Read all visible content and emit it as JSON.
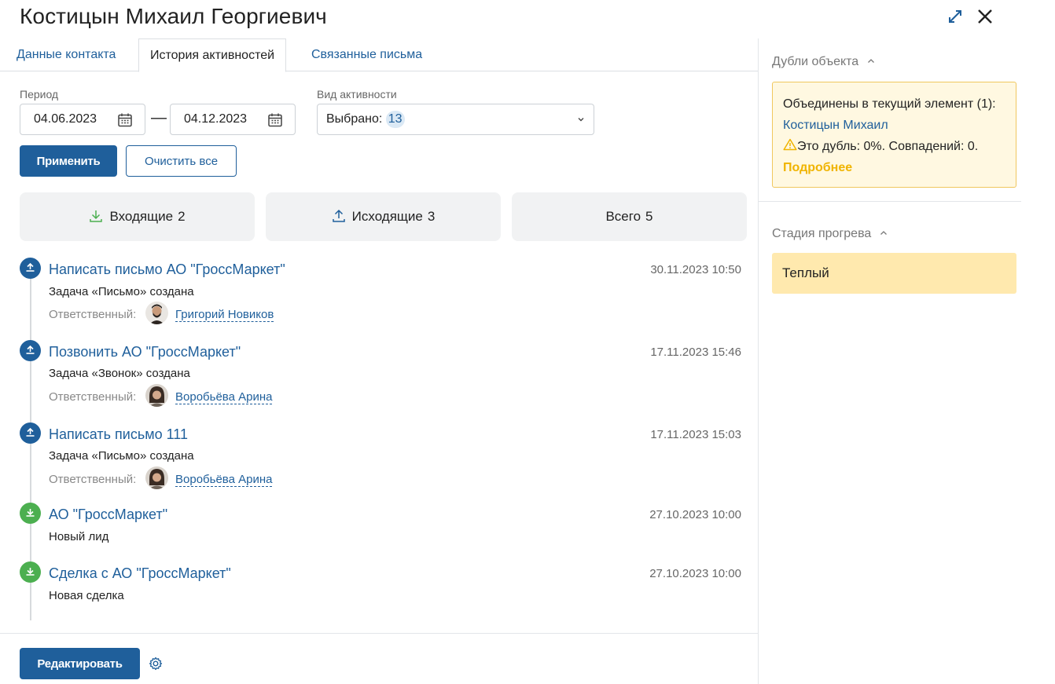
{
  "header": {
    "title": "Костицын Михаил Георгиевич"
  },
  "tabs": [
    {
      "label": "Данные контакта"
    },
    {
      "label": "История активностей"
    },
    {
      "label": "Связанные письма"
    }
  ],
  "filters": {
    "period_label": "Период",
    "date_from": "04.06.2023",
    "dash": "—",
    "date_to": "04.12.2023",
    "activity_type_label": "Вид активности",
    "selected_prefix": "Выбрано:",
    "selected_count": "13",
    "apply_label": "Применить",
    "clear_label": "Очистить все"
  },
  "stats": {
    "incoming_label": "Входящие",
    "incoming_count": "2",
    "outgoing_label": "Исходящие",
    "outgoing_count": "3",
    "total_label": "Всего",
    "total_count": "5"
  },
  "activities": [
    {
      "direction": "out",
      "title": "Написать письмо АО \"ГроссМаркет\"",
      "date": "30.11.2023 10:50",
      "subtitle": "Задача «Письмо» создана",
      "responsible_label": "Ответственный:",
      "responsible": "Григорий Новиков"
    },
    {
      "direction": "out",
      "title": "Позвонить АО \"ГроссМаркет\"",
      "date": "17.11.2023 15:46",
      "subtitle": "Задача «Звонок» создана",
      "responsible_label": "Ответственный:",
      "responsible": "Воробьёва Арина"
    },
    {
      "direction": "out",
      "title": "Написать письмо 111",
      "date": "17.11.2023 15:03",
      "subtitle": "Задача «Письмо» создана",
      "responsible_label": "Ответственный:",
      "responsible": "Воробьёва Арина"
    },
    {
      "direction": "in",
      "title": "АО \"ГроссМаркет\"",
      "date": "27.10.2023 10:00",
      "subtitle": "Новый лид"
    },
    {
      "direction": "in",
      "title": "Сделка с АО \"ГроссМаркет\"",
      "date": "27.10.2023 10:00",
      "subtitle": "Новая сделка"
    }
  ],
  "footer": {
    "edit_label": "Редактировать"
  },
  "sidebar": {
    "duplicates_title": "Дубли объекта",
    "dup_text_1": "Объединены в текущий элемент (1):",
    "dup_link": "Костицын Михаил",
    "dup_text_2": "Это дубль: 0%. Совпадений:",
    "dup_matches": "0.",
    "dup_more": "Подробнее",
    "stage_title": "Стадия прогрева",
    "stage_value": "Теплый"
  },
  "colors": {
    "accent": "#1f5f9b",
    "incoming": "#4caf50",
    "warning_bg": "#fff8e1",
    "stage_bg": "#ffe9ae"
  },
  "icons": [
    "expand-icon",
    "close-icon",
    "calendar-icon",
    "chevron-down-icon",
    "download-icon",
    "upload-icon",
    "gear-icon",
    "warning-icon",
    "chevron-up-icon"
  ]
}
